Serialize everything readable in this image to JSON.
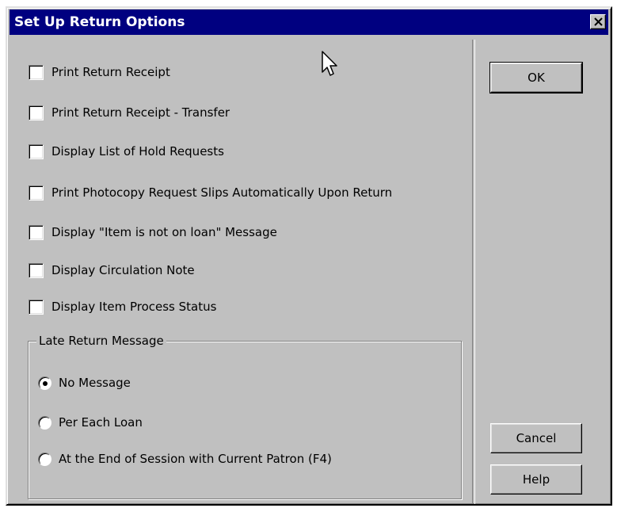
{
  "window": {
    "title": "Set Up Return Options",
    "close_symbol": "×"
  },
  "options": [
    {
      "label": "Print Return Receipt",
      "checked": false
    },
    {
      "label": "Print Return Receipt - Transfer",
      "checked": false
    },
    {
      "label": "Display List of Hold Requests",
      "checked": false
    },
    {
      "label": "Print Photocopy Request Slips Automatically Upon Return",
      "checked": false
    },
    {
      "label": "Display \"Item is not on loan\" Message",
      "checked": false
    },
    {
      "label": "Display Circulation Note",
      "checked": false
    },
    {
      "label": "Display Item Process Status",
      "checked": false
    }
  ],
  "late_return": {
    "group_label": "Late Return Message",
    "choices": [
      {
        "label": "No Message",
        "selected": true
      },
      {
        "label": "Per Each Loan",
        "selected": false
      },
      {
        "label": "At the End of Session with Current Patron (F4)",
        "selected": false
      }
    ]
  },
  "buttons": {
    "ok": "OK",
    "cancel": "Cancel",
    "help": "Help"
  },
  "colors": {
    "titlebar": "#000080",
    "dialog_face": "#c0c0c0"
  },
  "icons": {
    "close": "close-icon",
    "cursor": "mouse-pointer-icon"
  }
}
